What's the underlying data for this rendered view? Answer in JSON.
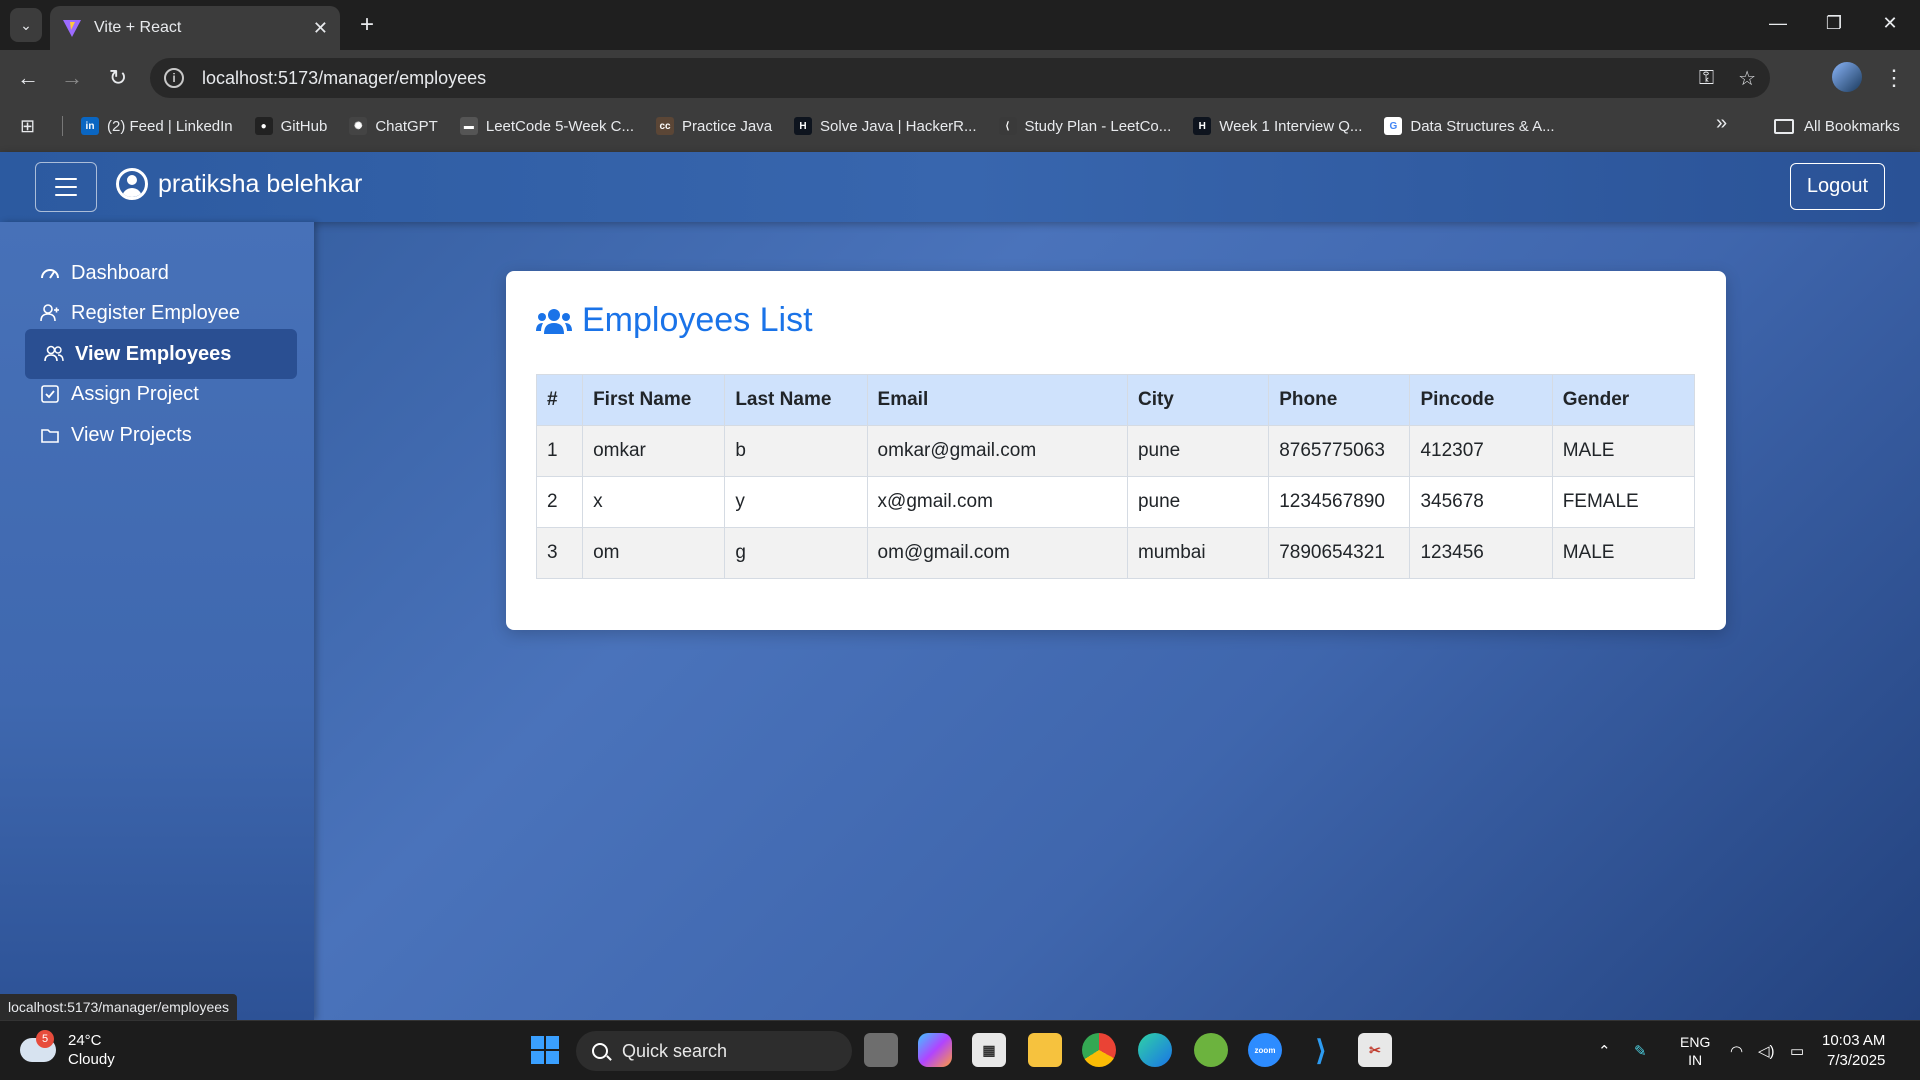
{
  "browser": {
    "tab_title": "Vite + React",
    "url": "localhost:5173/manager/employees",
    "bookmarks": [
      {
        "label": "(2) Feed | LinkedIn",
        "icon": "linkedin-icon",
        "color": "#0a66c2",
        "glyph": "in"
      },
      {
        "label": "GitHub",
        "icon": "github-icon",
        "color": "#222222",
        "glyph": "●"
      },
      {
        "label": "ChatGPT",
        "icon": "chatgpt-icon",
        "color": "#444444",
        "glyph": "✺"
      },
      {
        "label": "LeetCode 5-Week C...",
        "icon": "leetcode-icon",
        "color": "#555555",
        "glyph": "▬"
      },
      {
        "label": "Practice Java",
        "icon": "codechef-icon",
        "color": "#5b4636",
        "glyph": "cc"
      },
      {
        "label": "Solve Java | HackerR...",
        "icon": "hackerrank-icon",
        "color": "#0e141e",
        "glyph": "H"
      },
      {
        "label": "Study Plan - LeetCo...",
        "icon": "leetcode-icon",
        "color": "#3a3a3a",
        "glyph": "⟨"
      },
      {
        "label": "Week 1 Interview Q...",
        "icon": "hackerrank-icon",
        "color": "#0e141e",
        "glyph": "H"
      },
      {
        "label": "Data Structures & A...",
        "icon": "google-icon",
        "color": "#ffffff",
        "glyph": "G"
      }
    ],
    "all_bookmarks": "All Bookmarks",
    "status_url": "localhost:5173/manager/employees"
  },
  "app": {
    "username": "pratiksha belehkar",
    "logout_label": "Logout",
    "sidebar": [
      {
        "label": "Dashboard",
        "icon": "dashboard-icon",
        "active": false
      },
      {
        "label": "Register Employee",
        "icon": "user-plus-icon",
        "active": false
      },
      {
        "label": "View Employees",
        "icon": "users-icon",
        "active": true
      },
      {
        "label": "Assign Project",
        "icon": "check-square-icon",
        "active": false
      },
      {
        "label": "View Projects",
        "icon": "folder-icon",
        "active": false
      }
    ],
    "card_title": "Employees List",
    "table": {
      "headers": [
        "#",
        "First Name",
        "Last Name",
        "Email",
        "City",
        "Phone",
        "Pincode",
        "Gender"
      ],
      "rows": [
        [
          "1",
          "omkar",
          "b",
          "omkar@gmail.com",
          "pune",
          "8765775063",
          "412307",
          "MALE"
        ],
        [
          "2",
          "x",
          "y",
          "x@gmail.com",
          "pune",
          "1234567890",
          "345678",
          "FEMALE"
        ],
        [
          "3",
          "om",
          "g",
          "om@gmail.com",
          "mumbai",
          "7890654321",
          "123456",
          "MALE"
        ]
      ]
    }
  },
  "taskbar": {
    "weather_badge": "5",
    "temperature": "24°C",
    "condition": "Cloudy",
    "search_placeholder": "Quick search",
    "lang_top": "ENG",
    "lang_bottom": "IN",
    "time": "10:03 AM",
    "date": "7/3/2025"
  },
  "colors": {
    "accent": "#1a73e8",
    "header_row": "#cfe2fc",
    "active_nav": "#2a4f92"
  }
}
